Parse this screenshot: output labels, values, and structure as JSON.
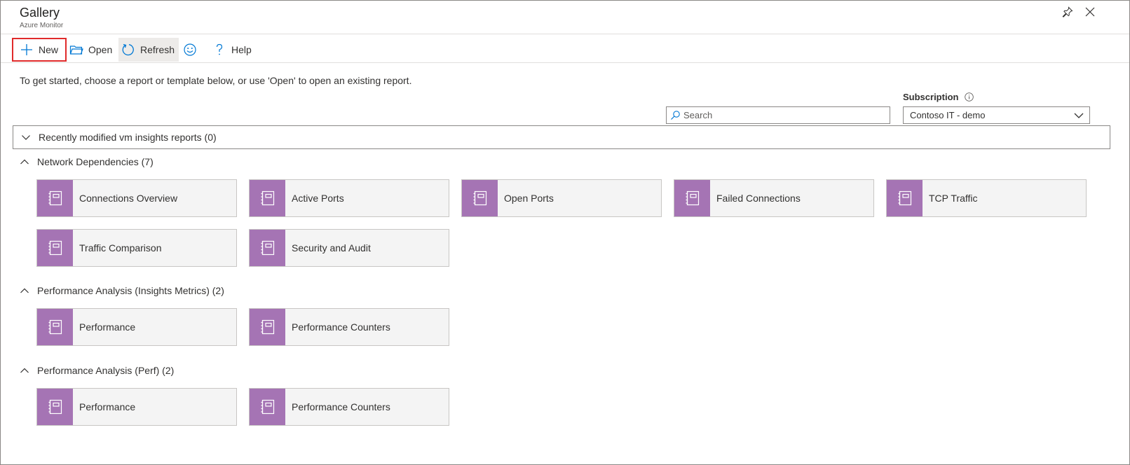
{
  "header": {
    "title": "Gallery",
    "subtitle": "Azure Monitor",
    "pin_icon": "pin-icon",
    "close_icon": "close-icon"
  },
  "toolbar": {
    "new_label": "New",
    "open_label": "Open",
    "refresh_label": "Refresh",
    "feedback_icon": "smiley-icon",
    "help_label": "Help"
  },
  "intro": "To get started, choose a report or template below, or use 'Open' to open an existing report.",
  "subscription": {
    "label": "Subscription",
    "value": "Contoso IT - demo"
  },
  "search": {
    "placeholder": "Search"
  },
  "recent": {
    "label": "Recently modified vm insights reports (0)"
  },
  "sections": [
    {
      "title": "Network Dependencies (7)",
      "tiles": [
        "Connections Overview",
        "Active Ports",
        "Open Ports",
        "Failed Connections",
        "TCP Traffic",
        "Traffic Comparison",
        "Security and Audit"
      ]
    },
    {
      "title": "Performance Analysis (Insights Metrics) (2)",
      "tiles": [
        "Performance",
        "Performance Counters"
      ]
    },
    {
      "title": "Performance Analysis (Perf) (2)",
      "tiles": [
        "Performance",
        "Performance Counters"
      ]
    }
  ],
  "colors": {
    "tile_accent": "#a574b4",
    "highlight_border": "#e02b2b",
    "azure_blue": "#0078d4"
  }
}
